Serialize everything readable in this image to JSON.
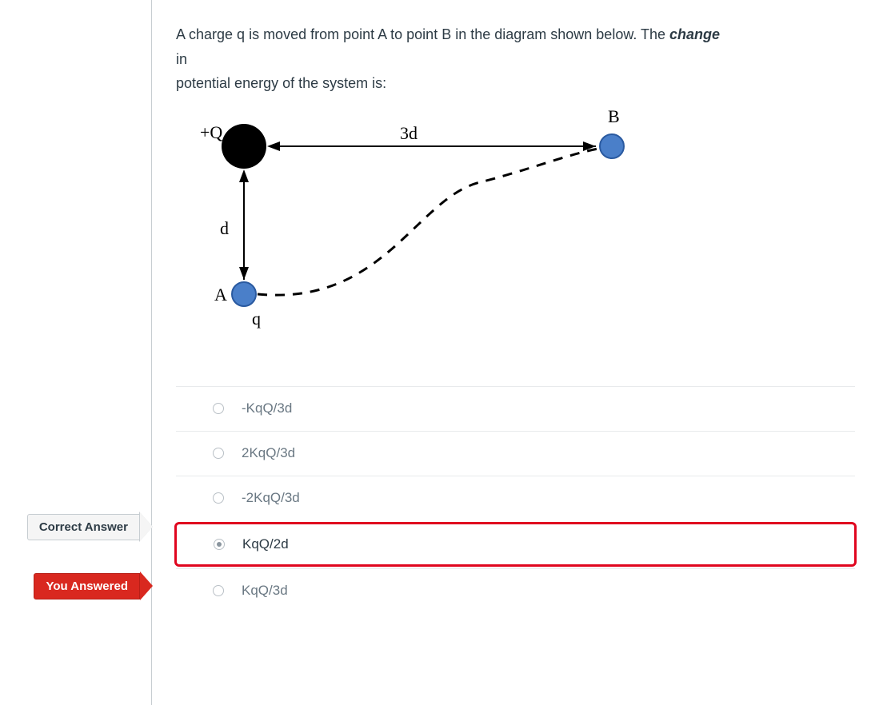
{
  "question": {
    "line1_pre": "A charge q is moved from point A to point B in the diagram shown below. The ",
    "line1_em": "change",
    "line2": "in",
    "line3": "potential energy of the system is:"
  },
  "diagram": {
    "labels": {
      "Q": "+Q",
      "B": "B",
      "A": "A",
      "q": "q",
      "d": "d",
      "three_d": "3d"
    }
  },
  "answers": [
    {
      "text": "-KqQ/3d",
      "selected": false,
      "is_correct": false,
      "is_user": false
    },
    {
      "text": "2KqQ/3d",
      "selected": false,
      "is_correct": false,
      "is_user": false
    },
    {
      "text": "-2KqQ/3d",
      "selected": false,
      "is_correct": true,
      "is_user": false
    },
    {
      "text": "KqQ/2d",
      "selected": true,
      "is_correct": false,
      "is_user": true
    },
    {
      "text": "KqQ/3d",
      "selected": false,
      "is_correct": false,
      "is_user": false
    }
  ],
  "badges": {
    "correct": "Correct Answer",
    "you_answered": "You Answered"
  },
  "colors": {
    "incorrect_red": "#e0061f",
    "badge_red": "#d9281f",
    "charge_blue": "#3b6fbf"
  }
}
